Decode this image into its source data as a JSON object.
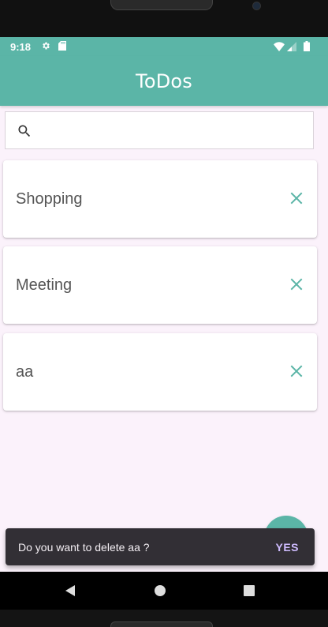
{
  "status_bar": {
    "time": "9:18",
    "icons": [
      "gear-icon",
      "sd-card-icon",
      "wifi-icon",
      "cell-signal-icon",
      "battery-icon"
    ]
  },
  "app_bar": {
    "title": "ToDos"
  },
  "search": {
    "placeholder": "",
    "value": "",
    "icon": "search-icon"
  },
  "todos": [
    {
      "label": "Shopping",
      "delete_icon": "close-icon"
    },
    {
      "label": "Meeting",
      "delete_icon": "close-icon"
    },
    {
      "label": "aa",
      "delete_icon": "close-icon"
    }
  ],
  "snackbar": {
    "message": "Do you want to delete aa ?",
    "action_label": "YES"
  },
  "nav_bar": {
    "icons": [
      "back-icon",
      "home-icon",
      "recents-icon"
    ]
  },
  "colors": {
    "primary": "#5bb5a7",
    "background": "#fbf2fb",
    "snackbar_bg": "#322f35",
    "snackbar_action": "#cfbcff",
    "todo_text": "#555555"
  }
}
